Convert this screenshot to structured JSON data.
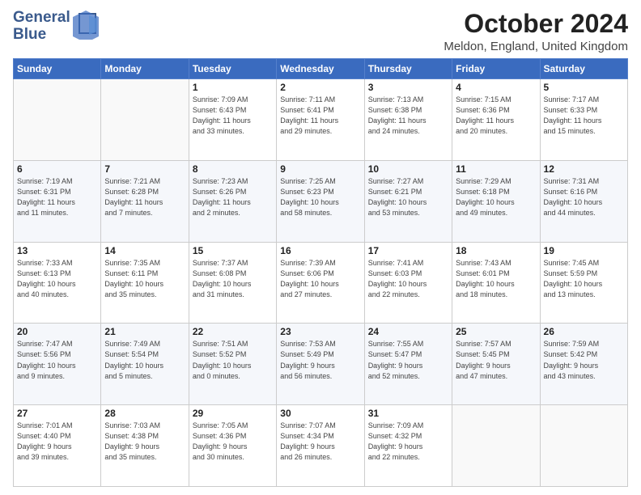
{
  "header": {
    "logo_line1": "General",
    "logo_line2": "Blue",
    "month": "October 2024",
    "location": "Meldon, England, United Kingdom"
  },
  "days_of_week": [
    "Sunday",
    "Monday",
    "Tuesday",
    "Wednesday",
    "Thursday",
    "Friday",
    "Saturday"
  ],
  "weeks": [
    [
      {
        "day": "",
        "info": ""
      },
      {
        "day": "",
        "info": ""
      },
      {
        "day": "1",
        "info": "Sunrise: 7:09 AM\nSunset: 6:43 PM\nDaylight: 11 hours\nand 33 minutes."
      },
      {
        "day": "2",
        "info": "Sunrise: 7:11 AM\nSunset: 6:41 PM\nDaylight: 11 hours\nand 29 minutes."
      },
      {
        "day": "3",
        "info": "Sunrise: 7:13 AM\nSunset: 6:38 PM\nDaylight: 11 hours\nand 24 minutes."
      },
      {
        "day": "4",
        "info": "Sunrise: 7:15 AM\nSunset: 6:36 PM\nDaylight: 11 hours\nand 20 minutes."
      },
      {
        "day": "5",
        "info": "Sunrise: 7:17 AM\nSunset: 6:33 PM\nDaylight: 11 hours\nand 15 minutes."
      }
    ],
    [
      {
        "day": "6",
        "info": "Sunrise: 7:19 AM\nSunset: 6:31 PM\nDaylight: 11 hours\nand 11 minutes."
      },
      {
        "day": "7",
        "info": "Sunrise: 7:21 AM\nSunset: 6:28 PM\nDaylight: 11 hours\nand 7 minutes."
      },
      {
        "day": "8",
        "info": "Sunrise: 7:23 AM\nSunset: 6:26 PM\nDaylight: 11 hours\nand 2 minutes."
      },
      {
        "day": "9",
        "info": "Sunrise: 7:25 AM\nSunset: 6:23 PM\nDaylight: 10 hours\nand 58 minutes."
      },
      {
        "day": "10",
        "info": "Sunrise: 7:27 AM\nSunset: 6:21 PM\nDaylight: 10 hours\nand 53 minutes."
      },
      {
        "day": "11",
        "info": "Sunrise: 7:29 AM\nSunset: 6:18 PM\nDaylight: 10 hours\nand 49 minutes."
      },
      {
        "day": "12",
        "info": "Sunrise: 7:31 AM\nSunset: 6:16 PM\nDaylight: 10 hours\nand 44 minutes."
      }
    ],
    [
      {
        "day": "13",
        "info": "Sunrise: 7:33 AM\nSunset: 6:13 PM\nDaylight: 10 hours\nand 40 minutes."
      },
      {
        "day": "14",
        "info": "Sunrise: 7:35 AM\nSunset: 6:11 PM\nDaylight: 10 hours\nand 35 minutes."
      },
      {
        "day": "15",
        "info": "Sunrise: 7:37 AM\nSunset: 6:08 PM\nDaylight: 10 hours\nand 31 minutes."
      },
      {
        "day": "16",
        "info": "Sunrise: 7:39 AM\nSunset: 6:06 PM\nDaylight: 10 hours\nand 27 minutes."
      },
      {
        "day": "17",
        "info": "Sunrise: 7:41 AM\nSunset: 6:03 PM\nDaylight: 10 hours\nand 22 minutes."
      },
      {
        "day": "18",
        "info": "Sunrise: 7:43 AM\nSunset: 6:01 PM\nDaylight: 10 hours\nand 18 minutes."
      },
      {
        "day": "19",
        "info": "Sunrise: 7:45 AM\nSunset: 5:59 PM\nDaylight: 10 hours\nand 13 minutes."
      }
    ],
    [
      {
        "day": "20",
        "info": "Sunrise: 7:47 AM\nSunset: 5:56 PM\nDaylight: 10 hours\nand 9 minutes."
      },
      {
        "day": "21",
        "info": "Sunrise: 7:49 AM\nSunset: 5:54 PM\nDaylight: 10 hours\nand 5 minutes."
      },
      {
        "day": "22",
        "info": "Sunrise: 7:51 AM\nSunset: 5:52 PM\nDaylight: 10 hours\nand 0 minutes."
      },
      {
        "day": "23",
        "info": "Sunrise: 7:53 AM\nSunset: 5:49 PM\nDaylight: 9 hours\nand 56 minutes."
      },
      {
        "day": "24",
        "info": "Sunrise: 7:55 AM\nSunset: 5:47 PM\nDaylight: 9 hours\nand 52 minutes."
      },
      {
        "day": "25",
        "info": "Sunrise: 7:57 AM\nSunset: 5:45 PM\nDaylight: 9 hours\nand 47 minutes."
      },
      {
        "day": "26",
        "info": "Sunrise: 7:59 AM\nSunset: 5:42 PM\nDaylight: 9 hours\nand 43 minutes."
      }
    ],
    [
      {
        "day": "27",
        "info": "Sunrise: 7:01 AM\nSunset: 4:40 PM\nDaylight: 9 hours\nand 39 minutes."
      },
      {
        "day": "28",
        "info": "Sunrise: 7:03 AM\nSunset: 4:38 PM\nDaylight: 9 hours\nand 35 minutes."
      },
      {
        "day": "29",
        "info": "Sunrise: 7:05 AM\nSunset: 4:36 PM\nDaylight: 9 hours\nand 30 minutes."
      },
      {
        "day": "30",
        "info": "Sunrise: 7:07 AM\nSunset: 4:34 PM\nDaylight: 9 hours\nand 26 minutes."
      },
      {
        "day": "31",
        "info": "Sunrise: 7:09 AM\nSunset: 4:32 PM\nDaylight: 9 hours\nand 22 minutes."
      },
      {
        "day": "",
        "info": ""
      },
      {
        "day": "",
        "info": ""
      }
    ]
  ]
}
